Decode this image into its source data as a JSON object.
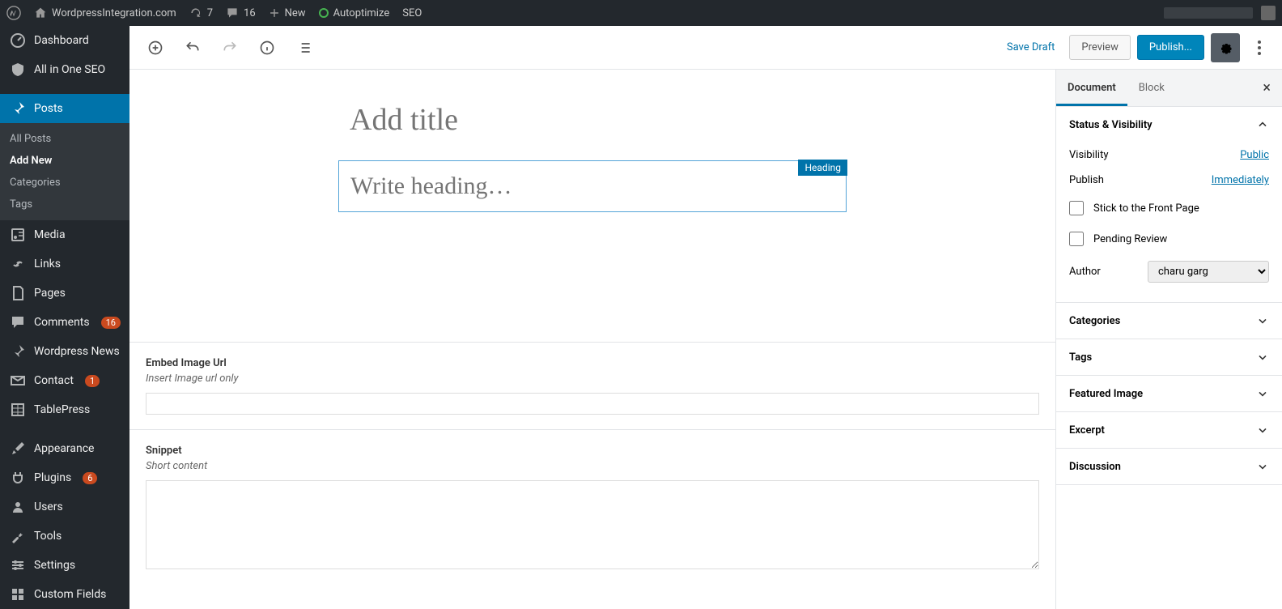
{
  "adminBar": {
    "siteName": "WordpressIntegration.com",
    "updates": "7",
    "comments": "16",
    "newLabel": "New",
    "autoptimize": "Autoptimize",
    "seo": "SEO"
  },
  "sidebar": {
    "dashboard": "Dashboard",
    "aioseo": "All in One SEO",
    "posts": "Posts",
    "postsSubmenu": {
      "all": "All Posts",
      "addNew": "Add New",
      "categories": "Categories",
      "tags": "Tags"
    },
    "media": "Media",
    "links": "Links",
    "pages": "Pages",
    "commentsMenu": "Comments",
    "commentsBadge": "16",
    "wpNews": "Wordpress News",
    "contact": "Contact",
    "contactBadge": "1",
    "tablepress": "TablePress",
    "appearance": "Appearance",
    "plugins": "Plugins",
    "pluginsBadge": "6",
    "users": "Users",
    "tools": "Tools",
    "settingsMenu": "Settings",
    "customFields": "Custom Fields"
  },
  "editor": {
    "saveDraft": "Save Draft",
    "preview": "Preview",
    "publish": "Publish...",
    "titlePlaceholder": "Add title",
    "headingPlaceholder": "Write heading…",
    "blockLabel": "Heading",
    "embedLabel": "Embed Image Url",
    "embedDesc": "Insert Image url only",
    "snippetLabel": "Snippet",
    "snippetDesc": "Short content"
  },
  "panel": {
    "documentTab": "Document",
    "blockTab": "Block",
    "statusVisibility": "Status & Visibility",
    "visibilityLabel": "Visibility",
    "visibilityValue": "Public",
    "publishLabel": "Publish",
    "publishValue": "Immediately",
    "stickFront": "Stick to the Front Page",
    "pendingReview": "Pending Review",
    "authorLabel": "Author",
    "authorValue": "charu garg",
    "categories": "Categories",
    "tags": "Tags",
    "featuredImage": "Featured Image",
    "excerpt": "Excerpt",
    "discussion": "Discussion"
  }
}
